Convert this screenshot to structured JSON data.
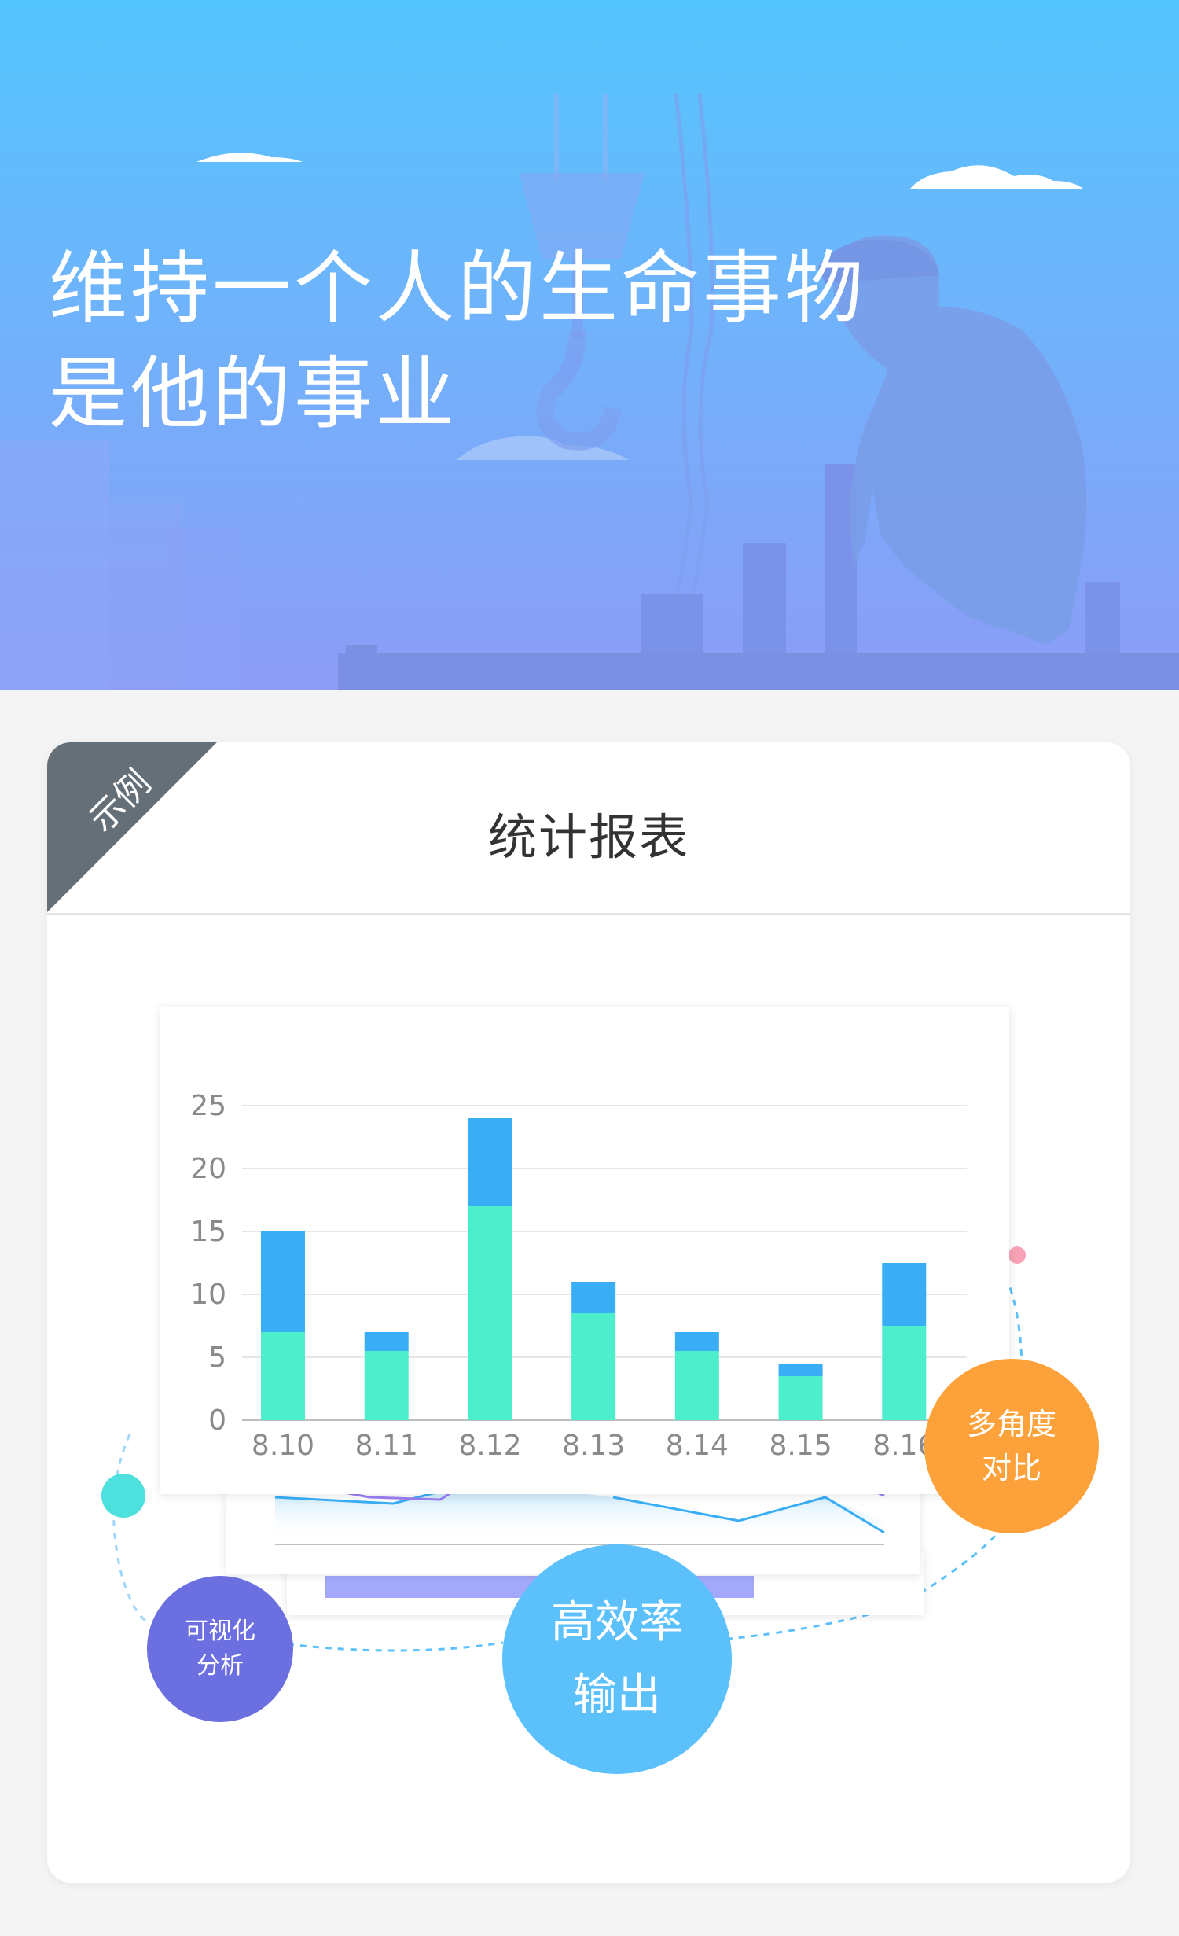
{
  "hero": {
    "line1": "维持一个人的生命事物",
    "line2": "是他的事业"
  },
  "card": {
    "corner_label": "示例",
    "title": "统计报表"
  },
  "badges": {
    "compare": [
      "多角度",
      "对比"
    ],
    "efficiency": [
      "高效率",
      "输出"
    ],
    "visual": [
      "可视化",
      "分析"
    ]
  },
  "colors": {
    "hero_top": "#54c6fd",
    "hero_bottom": "#8c9cf6",
    "bar_top": "#3aaef5",
    "bar_bottom": "#4deecb",
    "bubble_orange": "#fda23a",
    "bubble_blue": "#5cc1fb",
    "bubble_purple": "#6b6fe0",
    "corner": "#656f78"
  },
  "chart_data": {
    "type": "bar",
    "stacked": true,
    "categories": [
      "8.10",
      "8.11",
      "8.12",
      "8.13",
      "8.14",
      "8.15",
      "8.16"
    ],
    "series": [
      {
        "values": [
          7,
          5.5,
          17,
          8.5,
          5.5,
          3.5,
          7.5
        ]
      },
      {
        "values": [
          8,
          1.5,
          7,
          2.5,
          1.5,
          1,
          5
        ]
      }
    ],
    "yticks": [
      0,
      5,
      10,
      15,
      20,
      25
    ],
    "ylim": [
      0,
      25
    ],
    "grid": true
  }
}
